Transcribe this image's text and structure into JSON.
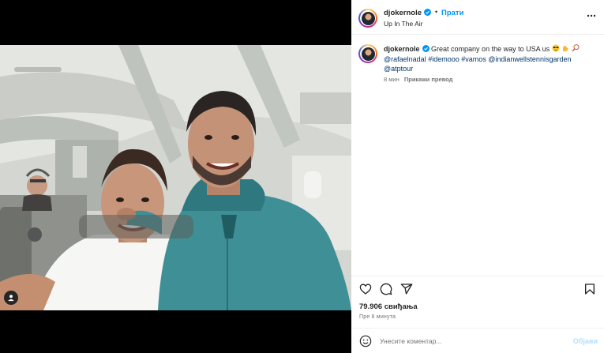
{
  "post": {
    "username": "djokernole",
    "follow_label": "Прати",
    "separator": "•",
    "location": "Up In The Air",
    "caption": {
      "username": "djokernole",
      "text_start": "Great company on the way to USA us",
      "emojis": [
        "sunglasses-emoji",
        "flexed-biceps-emoji",
        "tennis-emoji"
      ],
      "mentions": [
        "@rafaelnadal",
        "#idemooo",
        "#vamos",
        "@indianwellstennisgarden",
        "@atptour"
      ]
    },
    "caption_age": "8 мин",
    "translate_label": "Прикажи превод",
    "likes": "79.906 свиђања",
    "timestamp": "Пре 8 минута",
    "comment_placeholder": "Унесите коментар...",
    "post_button": "Објави"
  },
  "icons": {
    "header_more": "more-options-icon",
    "like": "heart-icon",
    "comment": "comment-icon",
    "share": "share-icon",
    "save": "bookmark-icon",
    "emoji": "smiley-icon",
    "tag": "user-tag-icon",
    "verified": "verified-badge-icon"
  },
  "colors": {
    "accent": "#0095f6",
    "link": "#00376b",
    "verified": "#0095f6",
    "post_disabled": "#b2dffc",
    "secondary_text": "#737373"
  }
}
